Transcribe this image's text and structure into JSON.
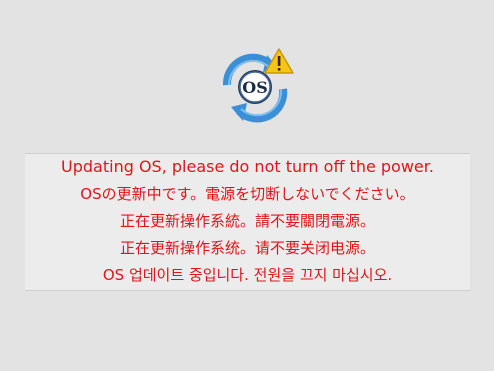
{
  "icon": {
    "name": "os-update-icon",
    "badge_text": "OS",
    "warning_icon": "warning-triangle-icon",
    "colors": {
      "arrows": "#3a8fd6",
      "arrows_dark": "#1d5fa3",
      "disk": "#2a4e7a",
      "warning": "#f5c518"
    }
  },
  "messages": {
    "english": "Updating OS, please do not turn off the power.",
    "japanese": "OSの更新中です。電源を切断しないでください。",
    "chinese_traditional": "正在更新操作系統。請不要關閉電源。",
    "chinese_simplified": "正在更新操作系统。请不要关闭电源。",
    "korean": "OS 업데이트 중입니다. 전원을 끄지 마십시오."
  },
  "colors": {
    "background": "#e3e3e3",
    "panel": "#ececec",
    "message_text": "#e0151a"
  }
}
